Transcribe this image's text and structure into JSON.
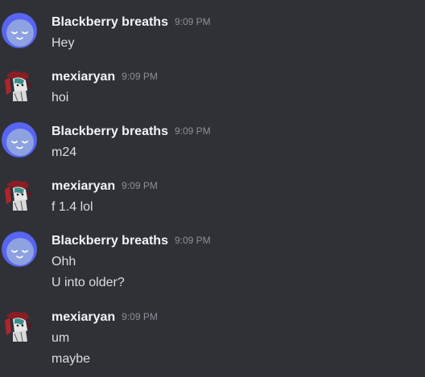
{
  "colors": {
    "background": "#2f3137",
    "username": "#f2f3f5",
    "timestamp": "#8e9097",
    "message_text": "#dbdee1",
    "bot_avatar_bg": "#5865f2"
  },
  "messages": [
    {
      "author": "Blackberry breaths",
      "time": "9:09 PM",
      "avatar": "blurple-sleepy-face-avatar",
      "lines": [
        "Hey"
      ]
    },
    {
      "author": "mexiaryan",
      "time": "9:09 PM",
      "avatar": "anime-character-avatar",
      "lines": [
        "hoi"
      ]
    },
    {
      "author": "Blackberry breaths",
      "time": "9:09 PM",
      "avatar": "blurple-sleepy-face-avatar",
      "lines": [
        "m24"
      ]
    },
    {
      "author": "mexiaryan",
      "time": "9:09 PM",
      "avatar": "anime-character-avatar",
      "lines": [
        "f 1.4 lol"
      ]
    },
    {
      "author": "Blackberry breaths",
      "time": "9:09 PM",
      "avatar": "blurple-sleepy-face-avatar",
      "lines": [
        "Ohh",
        "U into older?"
      ]
    },
    {
      "author": "mexiaryan",
      "time": "9:09 PM",
      "avatar": "anime-character-avatar",
      "lines": [
        "um",
        "maybe"
      ]
    }
  ]
}
